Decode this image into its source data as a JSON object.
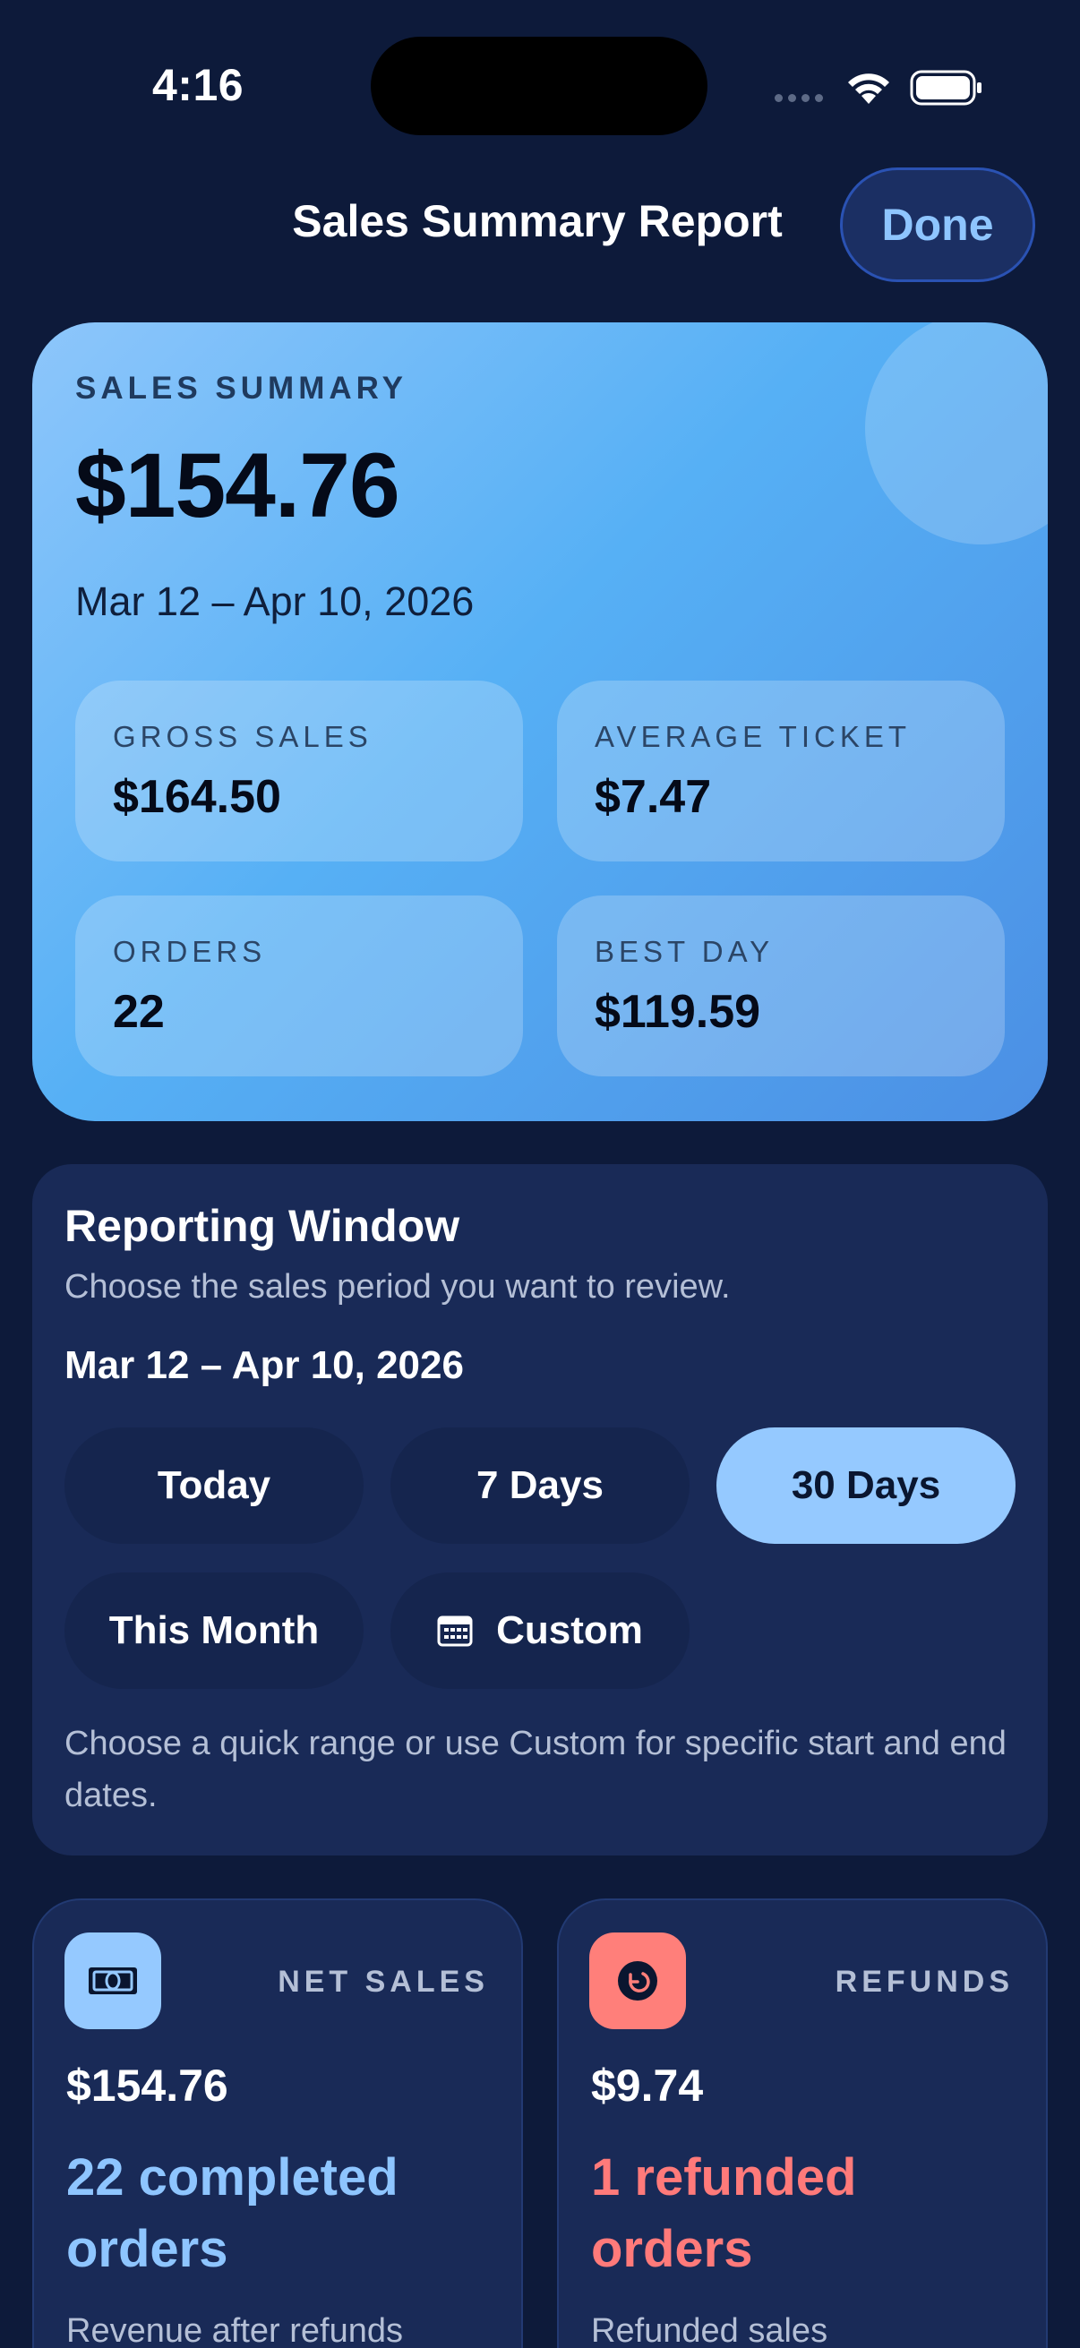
{
  "status_bar": {
    "time": "4:16"
  },
  "header": {
    "title": "Sales Summary Report",
    "done_label": "Done"
  },
  "hero": {
    "eyebrow": "SALES SUMMARY",
    "amount": "$154.76",
    "date_range": "Mar 12 – Apr 10, 2026",
    "tiles": [
      {
        "label": "GROSS SALES",
        "value": "$164.50"
      },
      {
        "label": "AVERAGE TICKET",
        "value": "$7.47"
      },
      {
        "label": "ORDERS",
        "value": "22"
      },
      {
        "label": "BEST DAY",
        "value": "$119.59"
      }
    ]
  },
  "reporting_window": {
    "title": "Reporting Window",
    "subtitle": "Choose the sales period you want to review.",
    "selected_range": "Mar 12 – Apr 10, 2026",
    "options": [
      {
        "label": "Today",
        "selected": false
      },
      {
        "label": "7 Days",
        "selected": false
      },
      {
        "label": "30 Days",
        "selected": true
      },
      {
        "label": "This Month",
        "selected": false
      },
      {
        "label": "Custom",
        "selected": false,
        "icon": "calendar-icon"
      }
    ],
    "note": "Choose a quick range or use Custom for specific start and end dates."
  },
  "metrics": [
    {
      "label": "NET SALES",
      "amount": "$154.76",
      "headline": "22 completed orders",
      "footnote": "Revenue after refunds",
      "icon": "cash-icon",
      "accent": "#8ec5ff",
      "icon_bg": "#95c9ff"
    },
    {
      "label": "REFUNDS",
      "amount": "$9.74",
      "headline": "1 refunded orders",
      "footnote": "Refunded sales",
      "icon": "refund-icon",
      "accent": "#ff7a7a",
      "icon_bg": "#ff7f7a"
    }
  ],
  "colors": {
    "background": "#0d1a3a",
    "card": "#192a57",
    "accent_blue": "#8ec5ff",
    "accent_red": "#ff7a7a"
  }
}
